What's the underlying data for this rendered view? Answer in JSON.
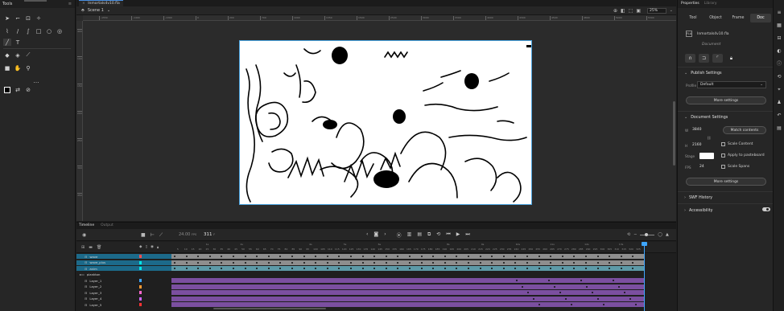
{
  "tools_panel": {
    "title": "Tools",
    "rows": [
      [
        "selection-tool",
        "subselection-tool",
        "free-transform-tool",
        "asset-warp-tool"
      ],
      [
        "brush-tool",
        "pencil-tool",
        "paint-brush-tool",
        "rectangle-tool",
        "oval-tool",
        "polystar-tool"
      ],
      [
        "line-tool",
        "text-tool"
      ],
      [
        "paint-bucket-tool",
        "ink-bottle-tool",
        "eyedropper-tool"
      ],
      [
        "camera-tool",
        "hand-tool",
        "zoom-tool"
      ],
      [
        "stroke-fill-color",
        "swap-colors"
      ]
    ]
  },
  "document": {
    "tab_label": "Inmortals4v10.fla",
    "scene_label": "Scene 1",
    "zoom": "25%"
  },
  "ruler": {
    "h_ticks": [
      "-1550",
      "-1400",
      "-1300",
      "0",
      "200",
      "700",
      "1000",
      "1350",
      "1500",
      "2500",
      "3000",
      "3300",
      "4000",
      "4300",
      "4500",
      "4800",
      "5000",
      "5300"
    ],
    "v_ticks": [
      "400",
      "1000",
      "1500",
      "2000",
      "2500",
      "3000",
      "3500"
    ]
  },
  "properties": {
    "panel_tabs": {
      "active": "Properties",
      "inactive": "Library"
    },
    "tabs": [
      "Tool",
      "Object",
      "Frame",
      "Doc"
    ],
    "active_tab": "Doc",
    "doc_name": "Inmortals4v10.fla",
    "doc_type": "Document",
    "publish": {
      "title": "Publish Settings",
      "profile_label": "Profile",
      "profile_value": "Default",
      "more_settings": "More settings"
    },
    "doc_settings": {
      "title": "Document Settings",
      "w_label": "W",
      "w_value": "3840",
      "h_label": "H",
      "h_value": "2160",
      "match_contents": "Match contents",
      "scale_content": "Scale Content",
      "stage_label": "Stage",
      "apply_pasteboard": "Apply to pasteboard",
      "fps_label": "FPS",
      "fps_value": "24",
      "scale_spans": "Scale Spans",
      "more_settings": "More settings",
      "stage_color": "#ffffff"
    },
    "swf_history": "SWF History",
    "accessibility": "Accessibility"
  },
  "timeline": {
    "tabs": {
      "active": "Timeline",
      "inactive": "Output"
    },
    "fps_display": "24.00",
    "fps_unit": "FPS",
    "current_frame": "311",
    "frame_numbers": [
      "5",
      "10",
      "15",
      "20",
      "25",
      "30",
      "35",
      "40",
      "45",
      "50",
      "55",
      "60",
      "65",
      "70",
      "75",
      "80",
      "85",
      "90",
      "95",
      "100",
      "105",
      "110",
      "115",
      "120",
      "125",
      "130",
      "135",
      "140",
      "145",
      "150",
      "155",
      "160",
      "165",
      "170",
      "175",
      "180",
      "185",
      "190",
      "195",
      "200",
      "205",
      "210",
      "215",
      "220",
      "225",
      "230",
      "235",
      "240",
      "245",
      "250",
      "255",
      "260",
      "265",
      "270",
      "275",
      "280",
      "285",
      "290",
      "295",
      "300",
      "305",
      "310",
      "315",
      "320",
      "325"
    ],
    "second_marks": [
      "1s",
      "2s",
      "4s",
      "5s",
      "6s",
      "8s",
      "9s",
      "10s",
      "11s",
      "12s",
      "13s"
    ],
    "layers": [
      {
        "name": "wave",
        "type": "layer",
        "color": "#ff4d4d",
        "frames": "gray",
        "selected": "sel"
      },
      {
        "name": "wave_plus",
        "type": "layer",
        "color": "#00e5e5",
        "frames": "gray",
        "selected": "sel"
      },
      {
        "name": "anim",
        "type": "layer",
        "color": "#00e5e5",
        "frames": "teal",
        "selected": "sel"
      },
      {
        "name": "plankton",
        "type": "folder",
        "color": "",
        "frames": "",
        "selected": ""
      },
      {
        "name": "Layer_1",
        "type": "layer",
        "color": "#3ea6ff",
        "frames": "purple",
        "selected": ""
      },
      {
        "name": "Layer_2",
        "type": "layer",
        "color": "#ff9933",
        "frames": "purple",
        "selected": ""
      },
      {
        "name": "Layer_3",
        "type": "layer",
        "color": "#ff66cc",
        "frames": "purple",
        "selected": ""
      },
      {
        "name": "Layer_4",
        "type": "layer",
        "color": "#cc66ff",
        "frames": "purple",
        "selected": ""
      },
      {
        "name": "Layer_5",
        "type": "layer",
        "color": "#ff3333",
        "frames": "purple",
        "selected": ""
      }
    ]
  },
  "dock_icons": [
    "properties-icon",
    "library-icon",
    "align-icon",
    "color-icon",
    "info-icon",
    "transform-icon",
    "code-snippets-icon",
    "motion-presets-icon",
    "history-icon",
    "components-icon"
  ]
}
